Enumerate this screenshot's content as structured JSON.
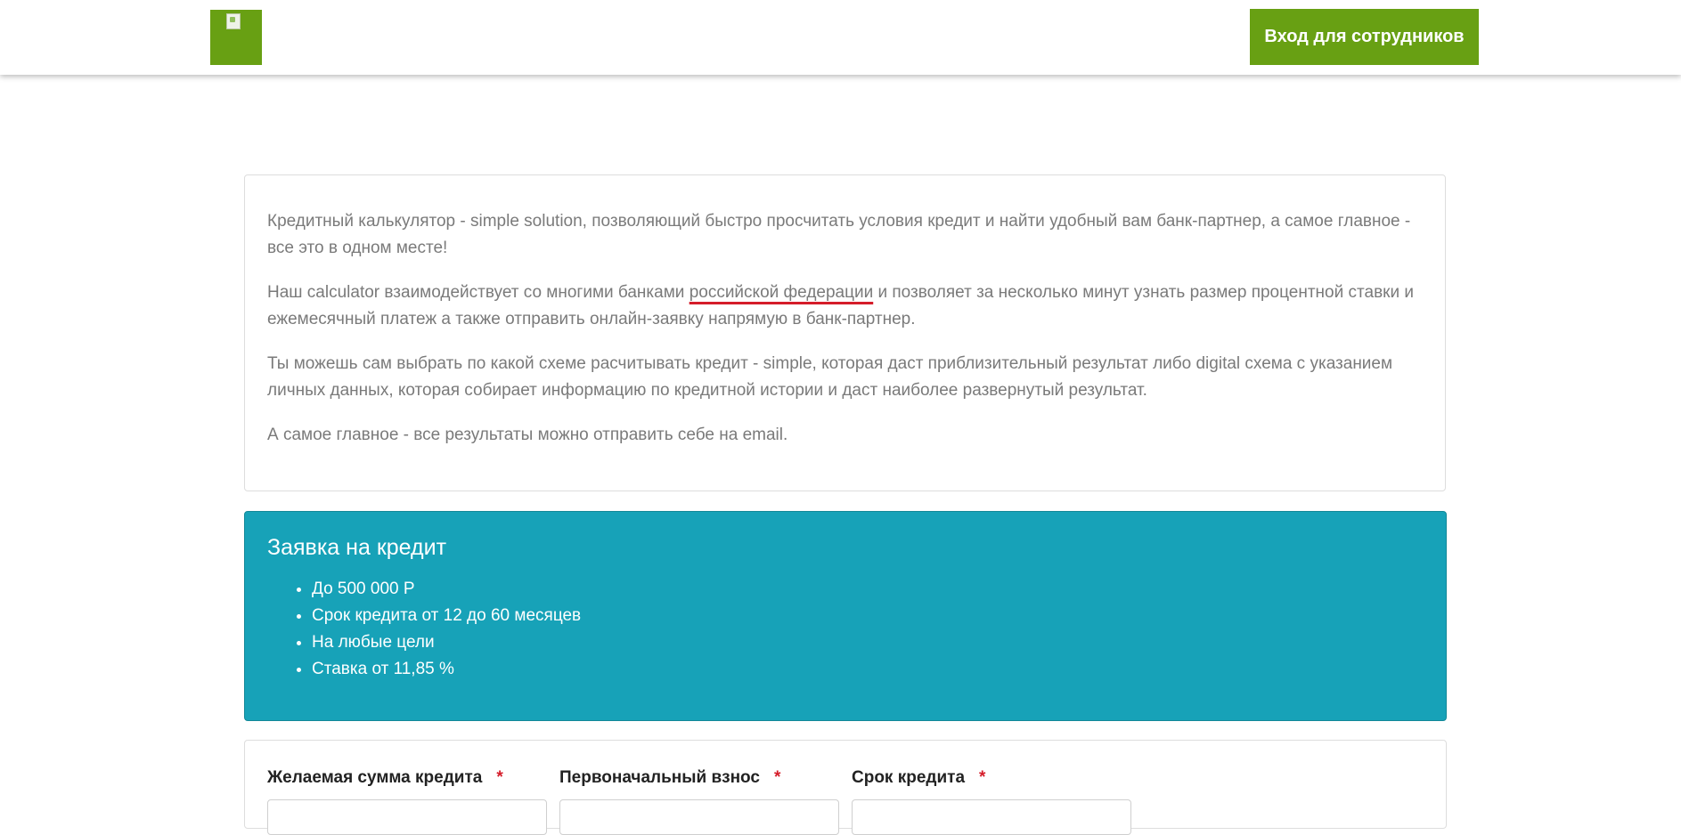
{
  "header": {
    "logo_alt": "",
    "staff_login_label": "Вход для сотрудников",
    "brand_color": "#68a013"
  },
  "intro": {
    "p1": "Кредитный калькулятор - simple solution, позволяющий быстро просчитать условия кредит и найти удобный вам банк-партнер, а самое главное - все это в одном месте!",
    "p2_before": "Наш calculator взаимодействует со многими банками ",
    "p2_underlined": "российской федерации",
    "p2_after": " и позволяет за несколько минут узнать размер процентной ставки и ежемесячный платеж а также отправить онлайн-заявку напрямую в банк-партнер.",
    "p3": "Ты можешь сам выбрать по какой схеме расчитывать кредит - simple, которая даст приблизительный результат либо digital схема с указанием личных данных, которая собирает информацию по кредитной истории и даст наиболее развернутый результат.",
    "p4": "А самое главное - все результаты можно отправить себе на email."
  },
  "promo": {
    "title": "Заявка на кредит",
    "items": [
      "До 500 000 Р",
      "Срок кредита от 12 до 60 месяцев",
      "На любые цели",
      "Ставка от 11,85 %"
    ],
    "background_color": "#17a2b8"
  },
  "form": {
    "fields": [
      {
        "label": "Желаемая сумма кредита",
        "required_mark": "*",
        "value": ""
      },
      {
        "label": "Первоначальный взнос",
        "required_mark": "*",
        "value": ""
      },
      {
        "label": "Срок кредита",
        "required_mark": "*",
        "value": ""
      }
    ],
    "required_color": "#d51d2a"
  }
}
